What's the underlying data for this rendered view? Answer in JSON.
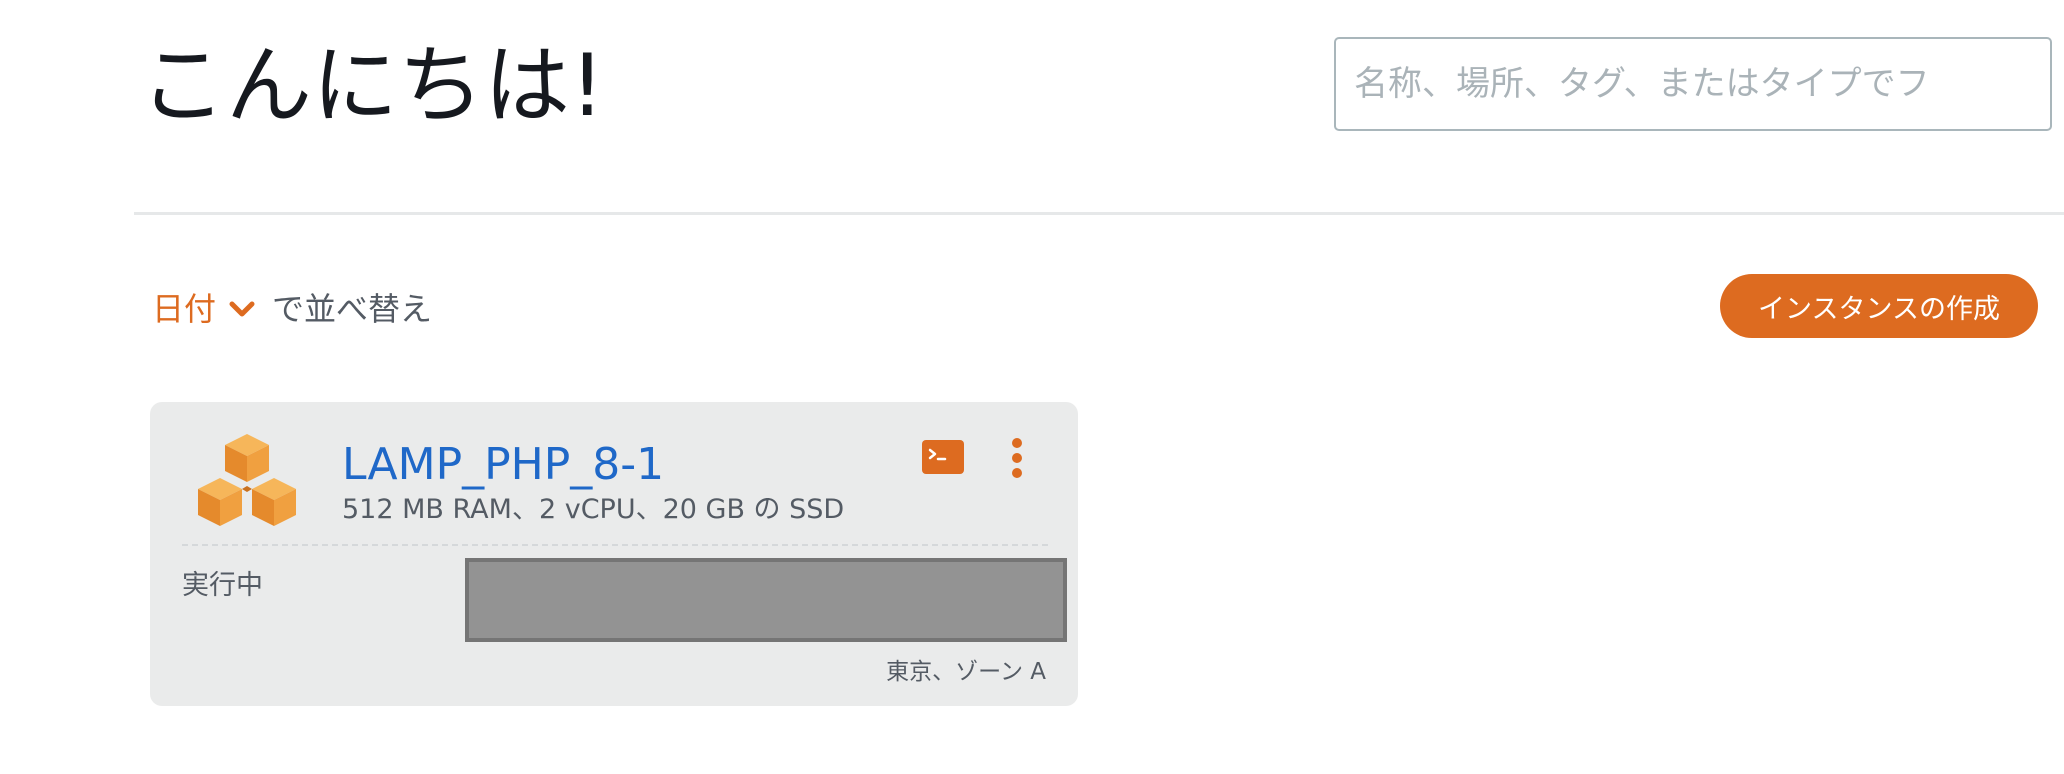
{
  "header": {
    "greeting": "こんにちは!",
    "search_placeholder": "名称、場所、タグ、またはタイプでフ"
  },
  "toolbar": {
    "sort_key": "日付",
    "sort_suffix": "で並べ替え",
    "create_label": "インスタンスの作成"
  },
  "instances": [
    {
      "name": "LAMP_PHP_8-1",
      "specs": "512 MB RAM、2 vCPU、20 GB の SSD",
      "status": "実行中",
      "location": "東京、ゾーン A",
      "icon": "cubes-icon"
    }
  ],
  "colors": {
    "accent": "#dd6b20",
    "link": "#1f68c8",
    "card_bg": "#eaebeb",
    "text_muted": "#545b64"
  }
}
